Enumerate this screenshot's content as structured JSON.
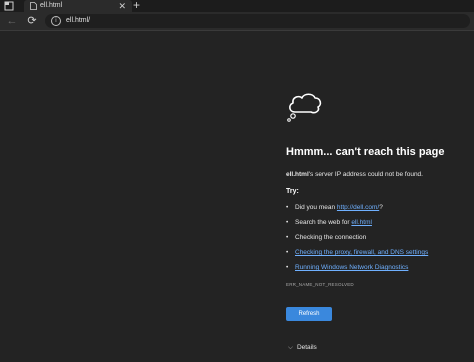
{
  "tab": {
    "title": "ell.html"
  },
  "address_bar": {
    "url": "ell.html/"
  },
  "error": {
    "headline": "Hmmm... can't reach this page",
    "host": "ell.html",
    "description_rest": "'s server IP address could not be found.",
    "try_label": "Try:",
    "suggestions": {
      "did_you_mean_prefix": "Did you mean ",
      "did_you_mean_link": "http://dell.com/",
      "did_you_mean_suffix": "?",
      "search_prefix": "Search the web for ",
      "search_link": "ell.html",
      "checking_connection": "Checking the connection",
      "proxy_link": "Checking the proxy, firewall, and DNS settings",
      "diagnostics_link": "Running Windows Network Diagnostics"
    },
    "error_code": "ERR_NAME_NOT_RESOLVED",
    "refresh_label": "Refresh",
    "details_label": "Details"
  },
  "icons": {
    "window_menu": "window-menu-icon",
    "tab_favicon": "page-icon",
    "tab_close": "close-icon",
    "new_tab": "plus-icon",
    "back": "back-arrow-icon",
    "reload": "reload-icon",
    "site_info": "info-icon",
    "cloud": "thought-cloud-icon",
    "details": "chevron-down-icon"
  },
  "colors": {
    "accent": "#3a88dd",
    "link": "#6fb0ff",
    "background": "#232323"
  }
}
